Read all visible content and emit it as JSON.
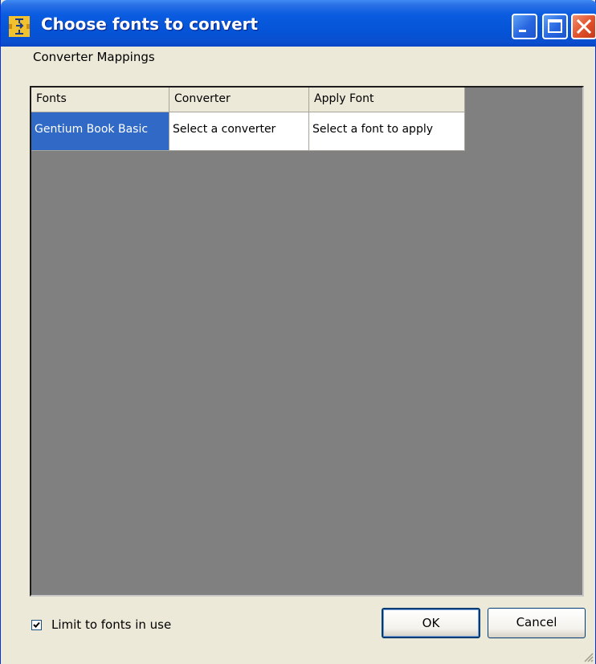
{
  "window": {
    "title": "Choose fonts to convert",
    "app_icon": "font-converter-icon",
    "title_buttons": [
      "minimize-icon",
      "maximize-icon",
      "close-icon"
    ]
  },
  "menu": {
    "label": "Converter Mappings"
  },
  "grid": {
    "headers": [
      "Fonts",
      "Converter",
      "Apply Font"
    ],
    "rows": [
      [
        "Gentium Book Basic",
        "Select a converter",
        "Select a font to apply"
      ]
    ],
    "background_color": "#808080",
    "selection_color": "#3169c6"
  },
  "footer": {
    "checkbox_label": "Limit to fonts in use",
    "checkbox_checked": true,
    "ok_label": "OK",
    "cancel_label": "Cancel"
  }
}
